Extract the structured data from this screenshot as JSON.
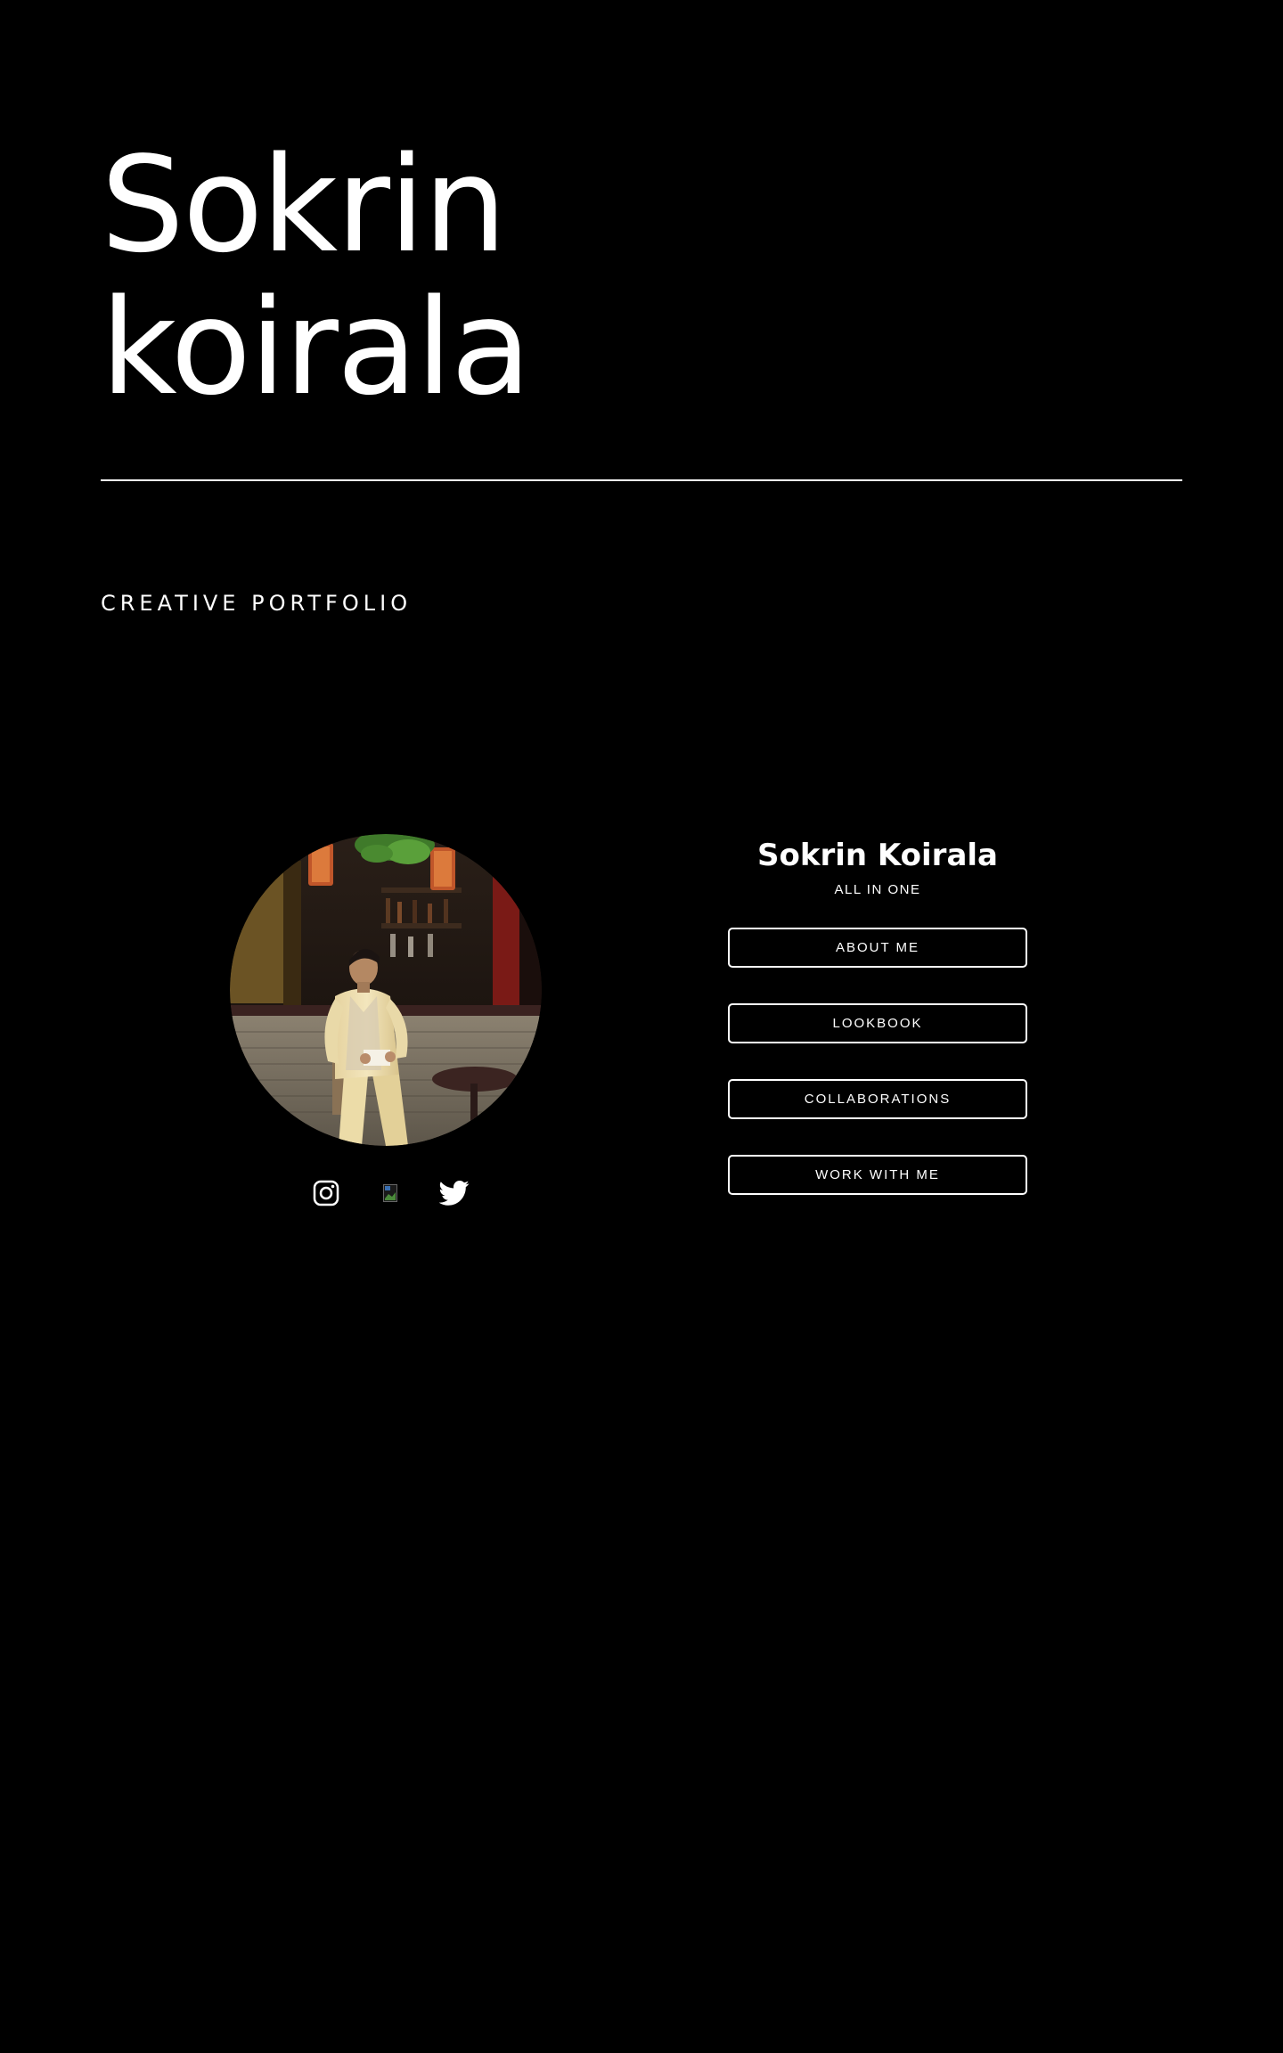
{
  "hero": {
    "title_line1": "Sokrin",
    "title_line2": "koirala",
    "subtitle": "CREATIVE PORTFOLIO"
  },
  "profile": {
    "avatar_alt": "Sokrin Koirala",
    "socials": [
      {
        "icon": "instagram-icon"
      },
      {
        "icon": "broken-image-icon"
      },
      {
        "icon": "twitter-icon"
      }
    ]
  },
  "card": {
    "name": "Sokrin Koirala",
    "tagline": "ALL IN ONE",
    "buttons": [
      {
        "label": "ABOUT ME"
      },
      {
        "label": "LOOKBOOK"
      },
      {
        "label": "COLLABORATIONS"
      },
      {
        "label": "WORK WITH ME"
      }
    ]
  },
  "colors": {
    "background": "#000000",
    "foreground": "#ffffff"
  }
}
